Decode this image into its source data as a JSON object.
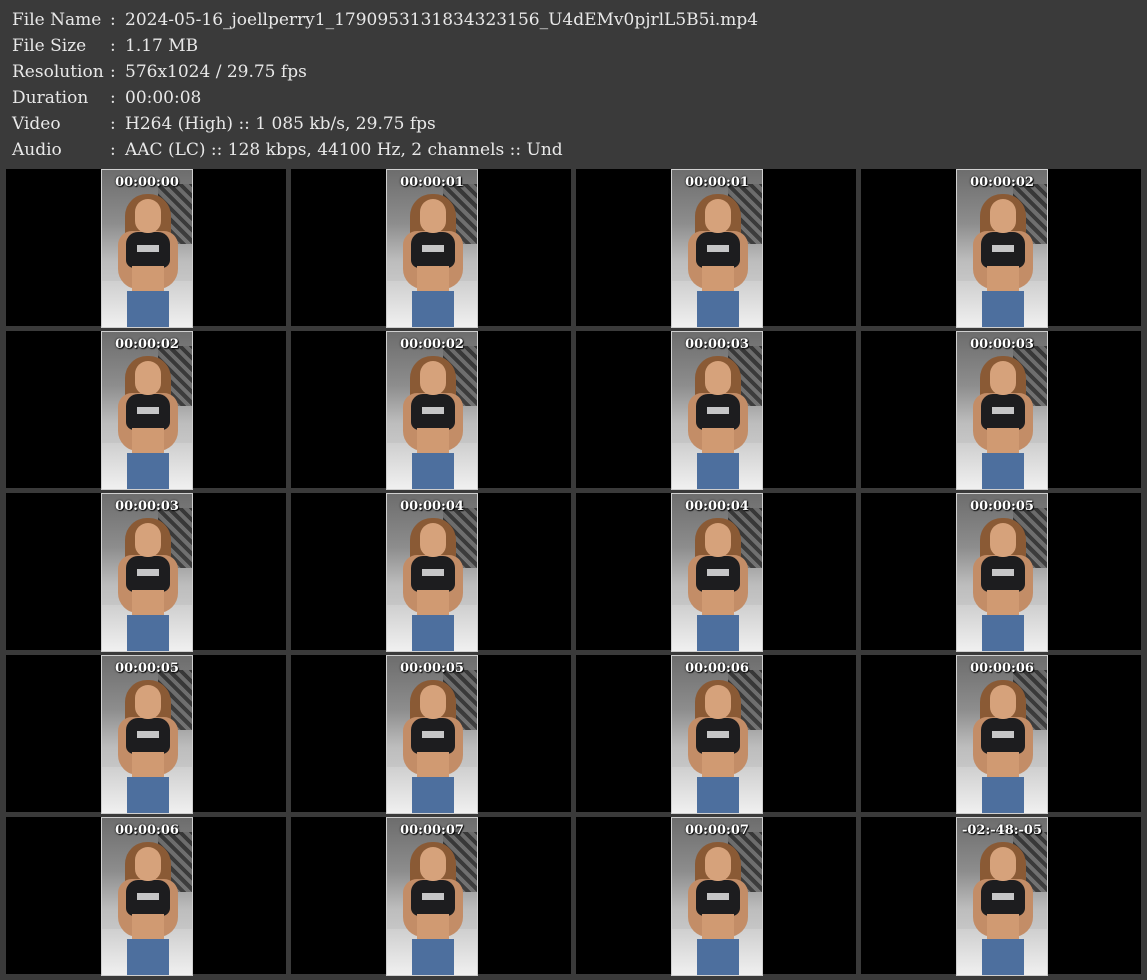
{
  "metadata": [
    {
      "label": "File Name",
      "value": "2024-05-16_joellperry1_1790953131834323156_U4dEMv0pjrlL5B5i.mp4"
    },
    {
      "label": "File Size",
      "value": "1.17 MB"
    },
    {
      "label": "Resolution",
      "value": "576x1024 / 29.75 fps"
    },
    {
      "label": "Duration",
      "value": "00:00:08"
    },
    {
      "label": "Video",
      "value": "H264 (High) :: 1 085 kb/s, 29.75 fps"
    },
    {
      "label": "Audio",
      "value": "AAC (LC) :: 128 kbps, 44100 Hz, 2 channels :: Und"
    }
  ],
  "separator": ":",
  "thumbnails": [
    "00:00:00",
    "00:00:01",
    "00:00:01",
    "00:00:02",
    "00:00:02",
    "00:00:02",
    "00:00:03",
    "00:00:03",
    "00:00:03",
    "00:00:04",
    "00:00:04",
    "00:00:05",
    "00:00:05",
    "00:00:05",
    "00:00:06",
    "00:00:06",
    "00:00:06",
    "00:00:07",
    "00:00:07",
    "-02:-48:-05"
  ]
}
